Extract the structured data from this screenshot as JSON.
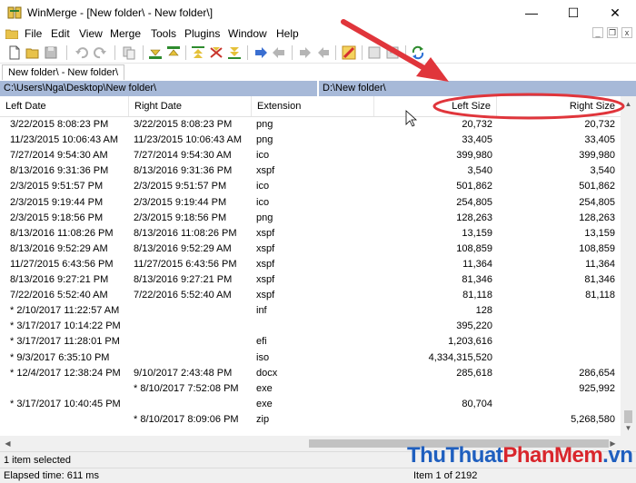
{
  "window": {
    "title": "WinMerge - [New folder\\ - New folder\\]",
    "minimize": "—",
    "maximize": "☐",
    "close": "✕"
  },
  "menu": {
    "items": [
      "File",
      "Edit",
      "View",
      "Merge",
      "Tools",
      "Plugins",
      "Window",
      "Help"
    ],
    "mdi_minimize": "_",
    "mdi_restore": "❐",
    "mdi_close": "x"
  },
  "tab": {
    "label": "New folder\\ - New folder\\"
  },
  "paths": {
    "left": "C:\\Users\\Nga\\Desktop\\New folder\\",
    "right": "D:\\New folder\\"
  },
  "columns": {
    "left_date": "Left Date",
    "right_date": "Right Date",
    "extension": "Extension",
    "left_size": "Left Size",
    "right_size": "Right Size"
  },
  "rows": [
    {
      "left_date": "3/22/2015 8:08:23 PM",
      "right_date": "3/22/2015 8:08:23 PM",
      "ext": "png",
      "left_size": "20,732",
      "right_size": "20,732"
    },
    {
      "left_date": "11/23/2015 10:06:43 AM",
      "right_date": "11/23/2015 10:06:43 AM",
      "ext": "png",
      "left_size": "33,405",
      "right_size": "33,405"
    },
    {
      "left_date": "7/27/2014 9:54:30 AM",
      "right_date": "7/27/2014 9:54:30 AM",
      "ext": "ico",
      "left_size": "399,980",
      "right_size": "399,980"
    },
    {
      "left_date": "8/13/2016 9:31:36 PM",
      "right_date": "8/13/2016 9:31:36 PM",
      "ext": "xspf",
      "left_size": "3,540",
      "right_size": "3,540"
    },
    {
      "left_date": "2/3/2015 9:51:57 PM",
      "right_date": "2/3/2015 9:51:57 PM",
      "ext": "ico",
      "left_size": "501,862",
      "right_size": "501,862"
    },
    {
      "left_date": "2/3/2015 9:19:44 PM",
      "right_date": "2/3/2015 9:19:44 PM",
      "ext": "ico",
      "left_size": "254,805",
      "right_size": "254,805"
    },
    {
      "left_date": "2/3/2015 9:18:56 PM",
      "right_date": "2/3/2015 9:18:56 PM",
      "ext": "png",
      "left_size": "128,263",
      "right_size": "128,263"
    },
    {
      "left_date": "8/13/2016 11:08:26 PM",
      "right_date": "8/13/2016 11:08:26 PM",
      "ext": "xspf",
      "left_size": "13,159",
      "right_size": "13,159"
    },
    {
      "left_date": "8/13/2016 9:52:29 AM",
      "right_date": "8/13/2016 9:52:29 AM",
      "ext": "xspf",
      "left_size": "108,859",
      "right_size": "108,859"
    },
    {
      "left_date": "11/27/2015 6:43:56 PM",
      "right_date": "11/27/2015 6:43:56 PM",
      "ext": "xspf",
      "left_size": "11,364",
      "right_size": "11,364"
    },
    {
      "left_date": "8/13/2016 9:27:21 PM",
      "right_date": "8/13/2016 9:27:21 PM",
      "ext": "xspf",
      "left_size": "81,346",
      "right_size": "81,346"
    },
    {
      "left_date": "7/22/2016 5:52:40 AM",
      "right_date": "7/22/2016 5:52:40 AM",
      "ext": "xspf",
      "left_size": "81,118",
      "right_size": "81,118"
    },
    {
      "left_date": "* 2/10/2017 11:22:57 AM",
      "right_date": "",
      "ext": "inf",
      "left_size": "128",
      "right_size": ""
    },
    {
      "left_date": "* 3/17/2017 10:14:22 PM",
      "right_date": "",
      "ext": "",
      "left_size": "395,220",
      "right_size": ""
    },
    {
      "left_date": "* 3/17/2017 11:28:01 PM",
      "right_date": "",
      "ext": "efi",
      "left_size": "1,203,616",
      "right_size": ""
    },
    {
      "left_date": "* 9/3/2017 6:35:10 PM",
      "right_date": "",
      "ext": "iso",
      "left_size": "4,334,315,520",
      "right_size": ""
    },
    {
      "left_date": "* 12/4/2017 12:38:24 PM",
      "right_date": "9/10/2017 2:43:48 PM",
      "ext": "docx",
      "left_size": "285,618",
      "right_size": "286,654"
    },
    {
      "left_date": "",
      "right_date": "* 8/10/2017 7:52:08 PM",
      "ext": "exe",
      "left_size": "",
      "right_size": "925,992"
    },
    {
      "left_date": "* 3/17/2017 10:40:45 PM",
      "right_date": "",
      "ext": "exe",
      "left_size": "80,704",
      "right_size": ""
    },
    {
      "left_date": "",
      "right_date": "* 8/10/2017 8:09:06 PM",
      "ext": "zip",
      "left_size": "",
      "right_size": "5,268,580"
    }
  ],
  "status": {
    "selection": "1 item selected",
    "elapsed": "Elapsed time: 611 ms",
    "item_position": "Item 1 of 2192"
  },
  "watermark": {
    "part1": "ThuThuat",
    "part2": "PhanMem",
    "part3": ".vn"
  },
  "colors": {
    "path_bar": "#a7b9d8",
    "annotation_red": "#e0353b",
    "watermark_blue": "#1f5fbf",
    "watermark_red": "#d9262c"
  }
}
